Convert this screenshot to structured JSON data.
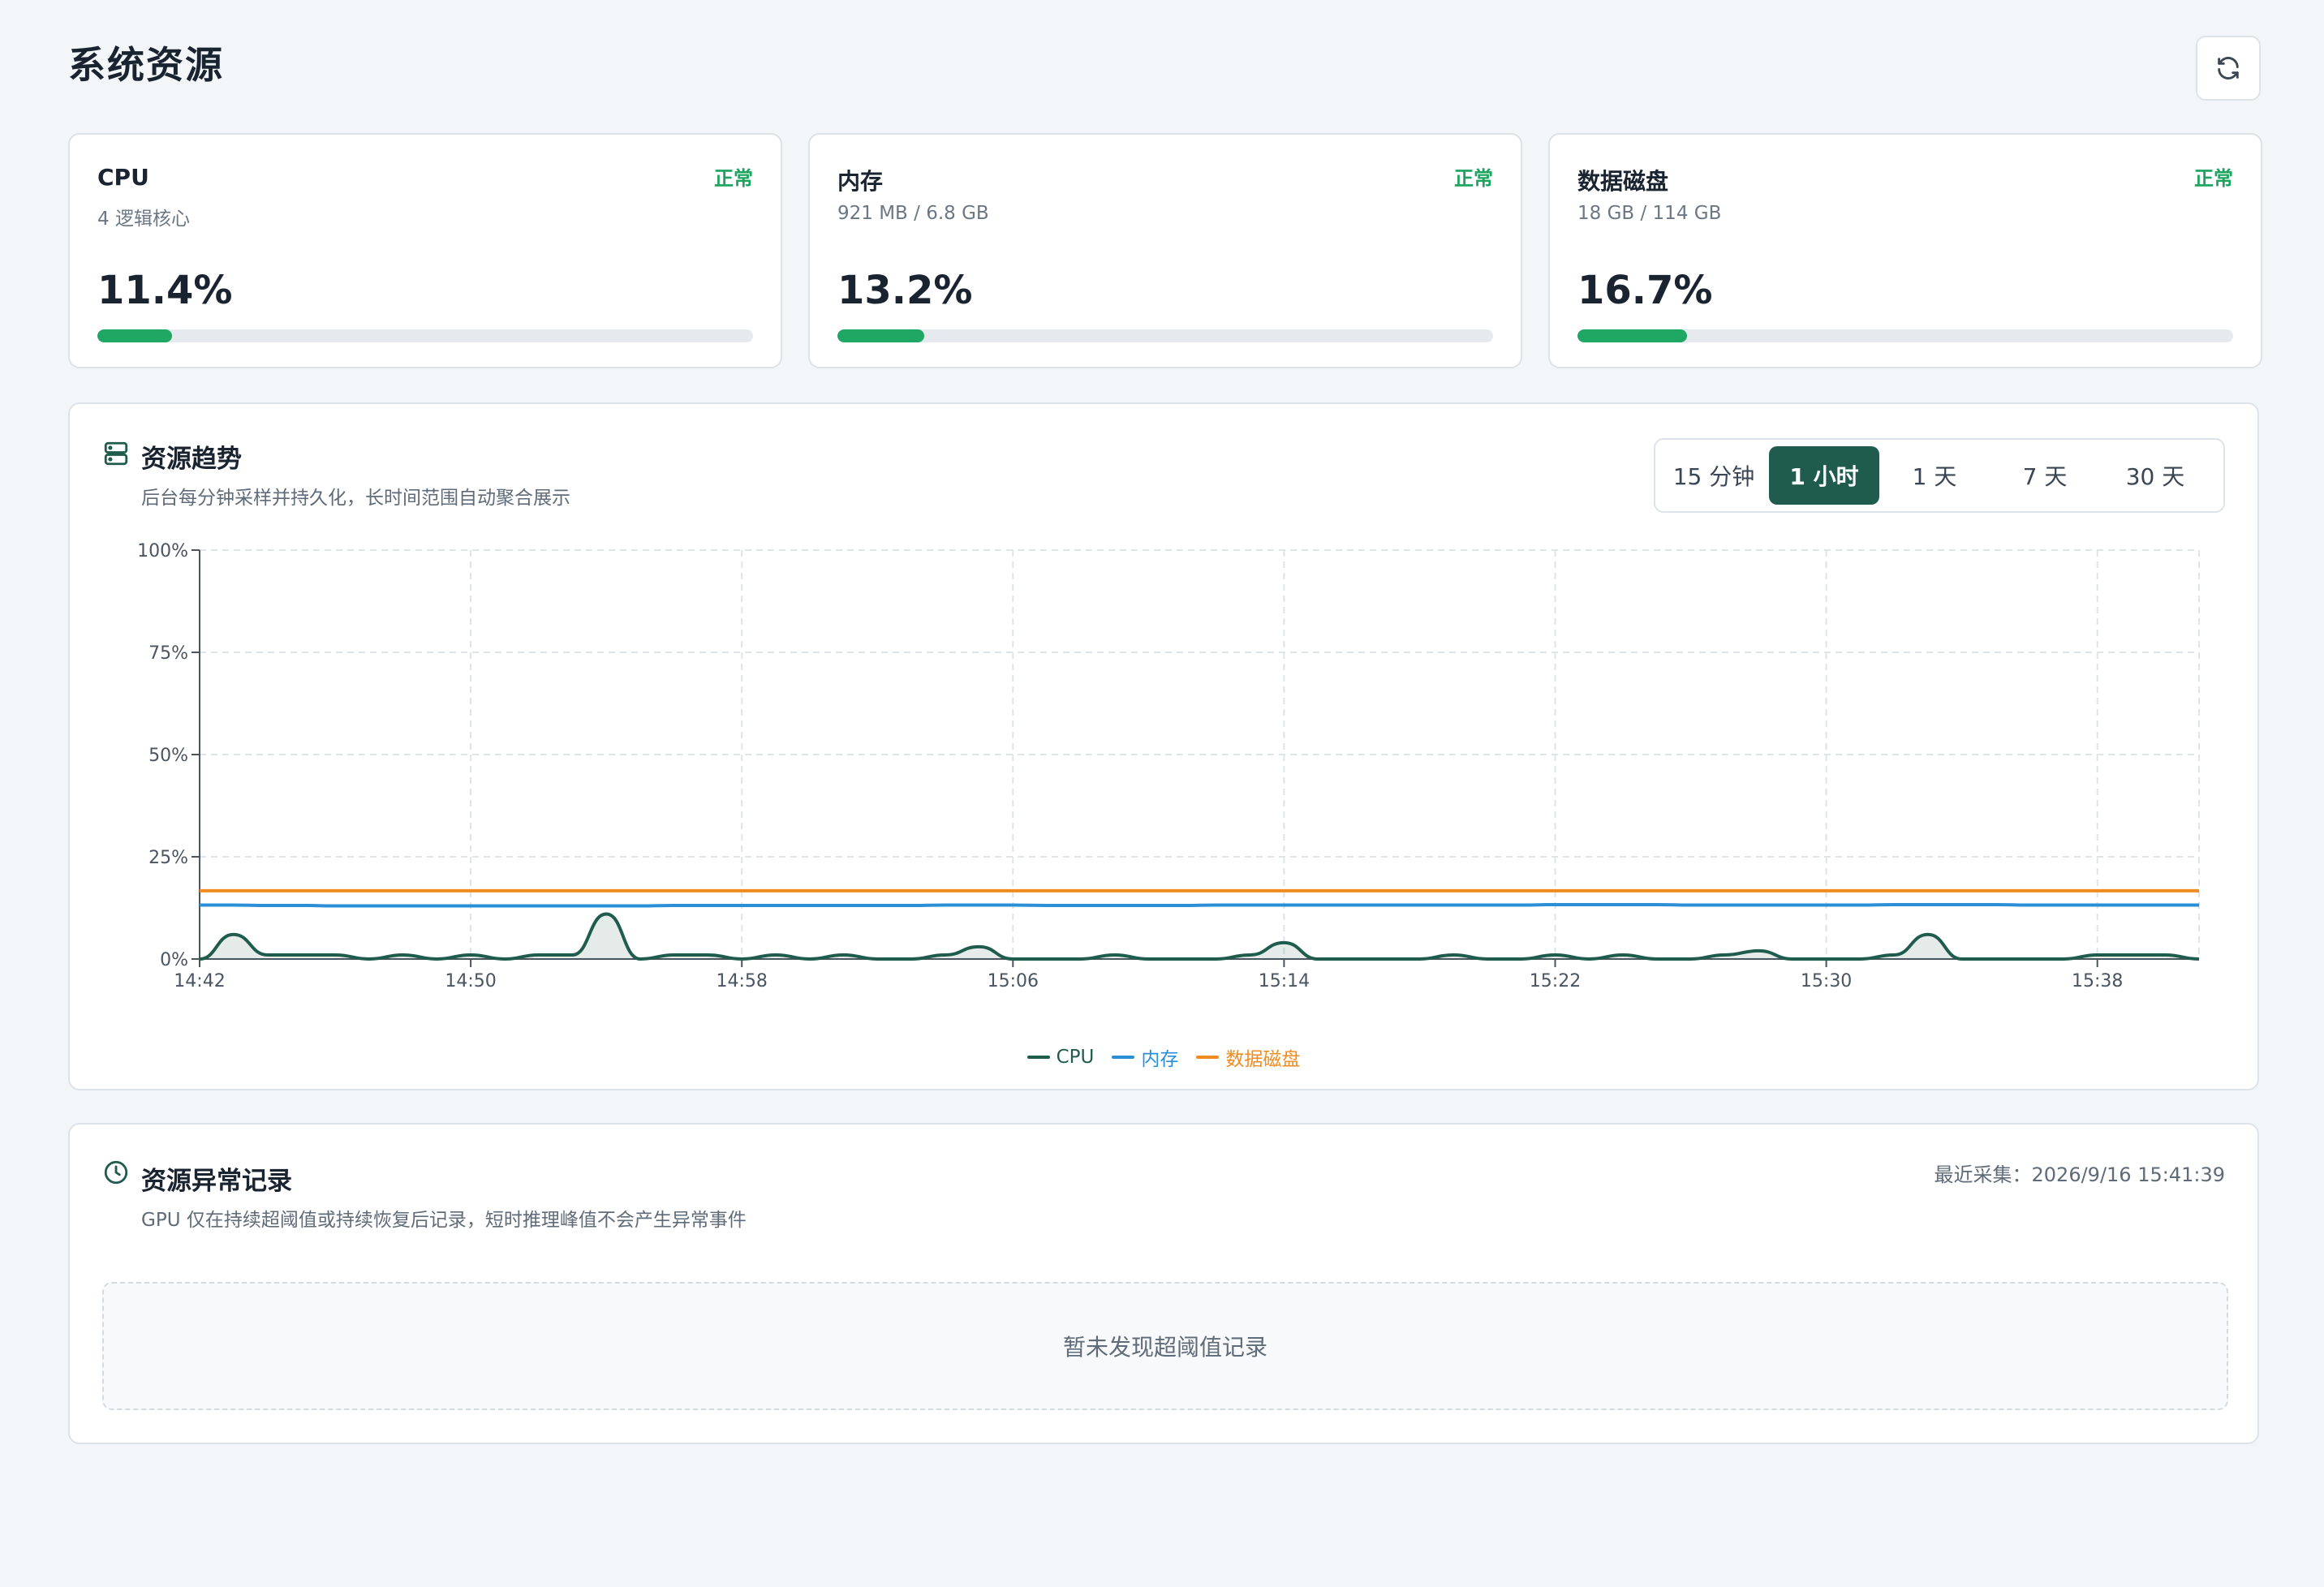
{
  "page": {
    "title": "系统资源"
  },
  "stats": [
    {
      "name": "CPU",
      "status": "正常",
      "sub": "4 逻辑核心",
      "value": "11.4%",
      "percent": 11.4
    },
    {
      "name": "内存",
      "status": "正常",
      "sub": "921 MB / 6.8 GB",
      "value": "13.2%",
      "percent": 13.2
    },
    {
      "name": "数据磁盘",
      "status": "正常",
      "sub": "18 GB / 114 GB",
      "value": "16.7%",
      "percent": 16.7
    }
  ],
  "trend": {
    "title": "资源趋势",
    "subtitle": "后台每分钟采样并持久化，长时间范围自动聚合展示",
    "ranges": [
      "15 分钟",
      "1 小时",
      "1 天",
      "7 天",
      "30 天"
    ],
    "active_range": "1 小时"
  },
  "colors": {
    "cpu": "#1f5c4e",
    "memory": "#2a8fd6",
    "disk": "#f08c1f",
    "accent": "#1f5c4e",
    "status_ok": "#1aa35d"
  },
  "chart_data": {
    "type": "line",
    "x": [
      "14:42",
      "14:43",
      "14:44",
      "14:45",
      "14:46",
      "14:47",
      "14:48",
      "14:49",
      "14:50",
      "14:51",
      "14:52",
      "14:53",
      "14:54",
      "14:55",
      "14:56",
      "14:57",
      "14:58",
      "14:59",
      "15:00",
      "15:01",
      "15:02",
      "15:03",
      "15:04",
      "15:05",
      "15:06",
      "15:07",
      "15:08",
      "15:09",
      "15:10",
      "15:11",
      "15:12",
      "15:13",
      "15:14",
      "15:15",
      "15:16",
      "15:17",
      "15:18",
      "15:19",
      "15:20",
      "15:21",
      "15:22",
      "15:23",
      "15:24",
      "15:25",
      "15:26",
      "15:27",
      "15:28",
      "15:29",
      "15:30",
      "15:31",
      "15:32",
      "15:33",
      "15:34",
      "15:35",
      "15:36",
      "15:37",
      "15:38",
      "15:39",
      "15:40",
      "15:41"
    ],
    "xticks": [
      "14:42",
      "14:50",
      "14:58",
      "15:06",
      "15:14",
      "15:22",
      "15:30",
      "15:38"
    ],
    "yticks": [
      "0%",
      "25%",
      "50%",
      "75%",
      "100%"
    ],
    "ylim": [
      0,
      100
    ],
    "grid": true,
    "legend_position": "bottom-center",
    "series": [
      {
        "name": "CPU",
        "key": "cpu",
        "values": [
          0,
          6,
          1,
          1,
          1,
          0,
          1,
          0,
          1,
          0,
          1,
          1,
          11,
          0,
          1,
          1,
          0,
          1,
          0,
          1,
          0,
          0,
          1,
          3,
          0,
          0,
          0,
          1,
          0,
          0,
          0,
          1,
          4,
          0,
          0,
          0,
          0,
          1,
          0,
          0,
          1,
          0,
          1,
          0,
          0,
          1,
          2,
          0,
          0,
          0,
          1,
          6,
          0,
          0,
          0,
          0,
          1,
          1,
          1,
          0
        ]
      },
      {
        "name": "内存",
        "key": "memory",
        "values": [
          13.2,
          13.2,
          13.1,
          13.1,
          13.0,
          13.0,
          13.0,
          13.0,
          13.0,
          13.0,
          13.0,
          13.0,
          13.0,
          13.0,
          13.1,
          13.1,
          13.1,
          13.1,
          13.1,
          13.1,
          13.1,
          13.1,
          13.2,
          13.2,
          13.2,
          13.1,
          13.1,
          13.1,
          13.1,
          13.1,
          13.2,
          13.2,
          13.2,
          13.2,
          13.2,
          13.2,
          13.2,
          13.2,
          13.2,
          13.2,
          13.3,
          13.3,
          13.3,
          13.3,
          13.2,
          13.2,
          13.2,
          13.2,
          13.2,
          13.2,
          13.3,
          13.3,
          13.3,
          13.3,
          13.2,
          13.2,
          13.2,
          13.2,
          13.2,
          13.2
        ]
      },
      {
        "name": "数据磁盘",
        "key": "disk",
        "values": [
          16.7,
          16.7,
          16.7,
          16.7,
          16.7,
          16.7,
          16.7,
          16.7,
          16.7,
          16.7,
          16.7,
          16.7,
          16.7,
          16.7,
          16.7,
          16.7,
          16.7,
          16.7,
          16.7,
          16.7,
          16.7,
          16.7,
          16.7,
          16.7,
          16.7,
          16.7,
          16.7,
          16.7,
          16.7,
          16.7,
          16.7,
          16.7,
          16.7,
          16.7,
          16.7,
          16.7,
          16.7,
          16.7,
          16.7,
          16.7,
          16.7,
          16.7,
          16.7,
          16.7,
          16.7,
          16.7,
          16.7,
          16.7,
          16.7,
          16.7,
          16.7,
          16.7,
          16.7,
          16.7,
          16.7,
          16.7,
          16.7,
          16.7,
          16.7,
          16.7
        ]
      }
    ]
  },
  "anomaly": {
    "title": "资源异常记录",
    "subtitle": "GPU 仅在持续超阈值或持续恢复后记录，短时推理峰值不会产生异常事件",
    "last_sample": "最近采集：2026/9/16 15:41:39",
    "empty_text": "暂未发现超阈值记录"
  },
  "icons": {
    "refresh": "refresh-icon",
    "trend": "server-icon",
    "anomaly": "clock-icon"
  }
}
